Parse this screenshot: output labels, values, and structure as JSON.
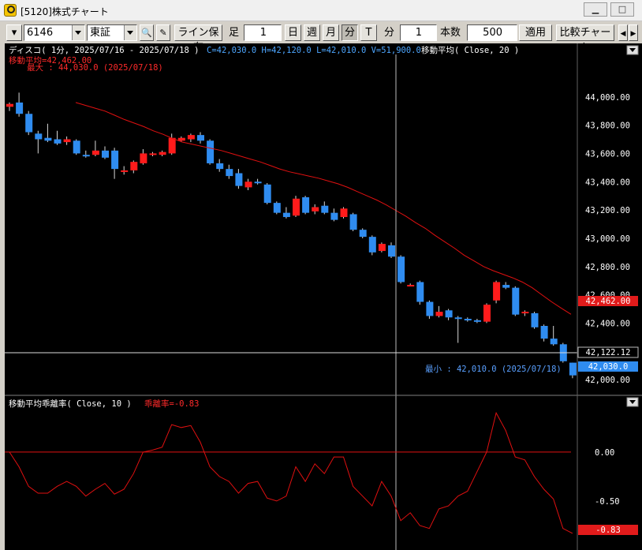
{
  "window": {
    "title": "[5120]株式チャート",
    "minimize_icon": "minimize-icon",
    "maximize_icon": "maximize-icon",
    "close_icon": "close-icon"
  },
  "toolbar": {
    "code": "6146",
    "market": "東証",
    "line_save_label": "ライン保存",
    "ashi_label": "足",
    "ashi_value": "1",
    "day_label": "日",
    "week_label": "週",
    "month_label": "月",
    "minute_label": "分",
    "tick_label": "T",
    "bun_label": "分",
    "bun_value": "1",
    "honsu_label": "本数",
    "honsu_value": "500",
    "apply_label": "適用",
    "compare_label": "比較チャート",
    "search_icon": "search-icon",
    "edit_icon": "edit-icon"
  },
  "colors": {
    "up": "#ff1b1b",
    "down": "#2f8cf0",
    "ma": "#e01010",
    "axis_text": "#ffffff",
    "info_blue": "#5aa0ff"
  },
  "main_panel": {
    "header_name": "ディスコ( 1分, 2025/07/16 - 2025/07/18 )",
    "ohlcv": "C=42,030.0 H=42,120.0 L=42,010.0 V=51,900.0",
    "ma_label": "移動平均( Close, 20 )",
    "ma_value_label": "移動平均=42,462.00",
    "max_label": "最大 : 44,030.0 (2025/07/18)",
    "min_label": "最小 : 42,010.0 (2025/07/18)",
    "ma_tag": "42,462.00",
    "cursor_tag": "42,122.12",
    "last_tag": "42,030.0"
  },
  "sub_panel": {
    "header_name": "移動平均乖離率( Close, 10 )",
    "value_label": "乖離率=-0.83",
    "last_tag": "-0.83"
  },
  "chart_data": [
    {
      "type": "candlestick",
      "title": "ディスコ( 1分, 2025/07/16 - 2025/07/18 )",
      "ylim": [
        41900,
        44300
      ],
      "y_ticks": [
        44000,
        43800,
        43600,
        43400,
        43200,
        43000,
        42800,
        42600,
        42400,
        42200,
        42000
      ],
      "y_tick_labels": [
        "44,000.00",
        "43,800.00",
        "43,600.00",
        "43,400.00",
        "43,200.00",
        "43,000.00",
        "42,800.00",
        "42,600.00",
        "42,400.00",
        "42,200.00",
        "42,000.00"
      ],
      "candles": [
        {
          "o": 43930,
          "h": 43960,
          "l": 43900,
          "c": 43950
        },
        {
          "o": 43960,
          "h": 44030,
          "l": 43860,
          "c": 43880
        },
        {
          "o": 43880,
          "h": 43900,
          "l": 43730,
          "c": 43750
        },
        {
          "o": 43740,
          "h": 43760,
          "l": 43600,
          "c": 43700
        },
        {
          "o": 43710,
          "h": 43810,
          "l": 43680,
          "c": 43690
        },
        {
          "o": 43700,
          "h": 43760,
          "l": 43660,
          "c": 43670
        },
        {
          "o": 43680,
          "h": 43720,
          "l": 43660,
          "c": 43700
        },
        {
          "o": 43690,
          "h": 43700,
          "l": 43590,
          "c": 43600
        },
        {
          "o": 43590,
          "h": 43620,
          "l": 43570,
          "c": 43580
        },
        {
          "o": 43590,
          "h": 43690,
          "l": 43580,
          "c": 43620
        },
        {
          "o": 43620,
          "h": 43650,
          "l": 43560,
          "c": 43570
        },
        {
          "o": 43620,
          "h": 43640,
          "l": 43420,
          "c": 43490
        },
        {
          "o": 43470,
          "h": 43510,
          "l": 43450,
          "c": 43480
        },
        {
          "o": 43480,
          "h": 43550,
          "l": 43460,
          "c": 43540
        },
        {
          "o": 43530,
          "h": 43630,
          "l": 43520,
          "c": 43600
        },
        {
          "o": 43590,
          "h": 43610,
          "l": 43580,
          "c": 43600
        },
        {
          "o": 43590,
          "h": 43620,
          "l": 43580,
          "c": 43610
        },
        {
          "o": 43600,
          "h": 43740,
          "l": 43590,
          "c": 43710
        },
        {
          "o": 43690,
          "h": 43720,
          "l": 43680,
          "c": 43710
        },
        {
          "o": 43700,
          "h": 43740,
          "l": 43680,
          "c": 43730
        },
        {
          "o": 43730,
          "h": 43750,
          "l": 43670,
          "c": 43690
        },
        {
          "o": 43690,
          "h": 43700,
          "l": 43520,
          "c": 43530
        },
        {
          "o": 43530,
          "h": 43560,
          "l": 43470,
          "c": 43490
        },
        {
          "o": 43490,
          "h": 43520,
          "l": 43420,
          "c": 43440
        },
        {
          "o": 43460,
          "h": 43490,
          "l": 43350,
          "c": 43370
        },
        {
          "o": 43360,
          "h": 43420,
          "l": 43340,
          "c": 43400
        },
        {
          "o": 43400,
          "h": 43420,
          "l": 43380,
          "c": 43390
        },
        {
          "o": 43380,
          "h": 43390,
          "l": 43240,
          "c": 43250
        },
        {
          "o": 43250,
          "h": 43260,
          "l": 43170,
          "c": 43180
        },
        {
          "o": 43180,
          "h": 43220,
          "l": 43140,
          "c": 43150
        },
        {
          "o": 43160,
          "h": 43300,
          "l": 43150,
          "c": 43280
        },
        {
          "o": 43290,
          "h": 43300,
          "l": 43170,
          "c": 43180
        },
        {
          "o": 43190,
          "h": 43240,
          "l": 43170,
          "c": 43220
        },
        {
          "o": 43230,
          "h": 43260,
          "l": 43170,
          "c": 43180
        },
        {
          "o": 43180,
          "h": 43210,
          "l": 43120,
          "c": 43130
        },
        {
          "o": 43150,
          "h": 43220,
          "l": 43140,
          "c": 43210
        },
        {
          "o": 43170,
          "h": 43180,
          "l": 43050,
          "c": 43060
        },
        {
          "o": 43060,
          "h": 43070,
          "l": 43000,
          "c": 43010
        },
        {
          "o": 43010,
          "h": 43020,
          "l": 42880,
          "c": 42900
        },
        {
          "o": 42910,
          "h": 42970,
          "l": 42900,
          "c": 42960
        },
        {
          "o": 42950,
          "h": 42970,
          "l": 42860,
          "c": 42870
        },
        {
          "o": 42870,
          "h": 42880,
          "l": 42680,
          "c": 42690
        },
        {
          "o": 42660,
          "h": 42680,
          "l": 42660,
          "c": 42670
        },
        {
          "o": 42690,
          "h": 42700,
          "l": 42530,
          "c": 42550
        },
        {
          "o": 42550,
          "h": 42560,
          "l": 42430,
          "c": 42450
        },
        {
          "o": 42450,
          "h": 42520,
          "l": 42440,
          "c": 42480
        },
        {
          "o": 42490,
          "h": 42500,
          "l": 42420,
          "c": 42440
        },
        {
          "o": 42440,
          "h": 42450,
          "l": 42260,
          "c": 42430
        },
        {
          "o": 42430,
          "h": 42440,
          "l": 42410,
          "c": 42420
        },
        {
          "o": 42420,
          "h": 42430,
          "l": 42400,
          "c": 42410
        },
        {
          "o": 42410,
          "h": 42540,
          "l": 42400,
          "c": 42530
        },
        {
          "o": 42560,
          "h": 42700,
          "l": 42540,
          "c": 42690
        },
        {
          "o": 42670,
          "h": 42690,
          "l": 42640,
          "c": 42650
        },
        {
          "o": 42650,
          "h": 42660,
          "l": 42450,
          "c": 42460
        },
        {
          "o": 42470,
          "h": 42490,
          "l": 42450,
          "c": 42480
        },
        {
          "o": 42470,
          "h": 42480,
          "l": 42360,
          "c": 42370
        },
        {
          "o": 42380,
          "h": 42390,
          "l": 42270,
          "c": 42290
        },
        {
          "o": 42290,
          "h": 42380,
          "l": 42240,
          "c": 42250
        },
        {
          "o": 42250,
          "h": 42260,
          "l": 42120,
          "c": 42130
        },
        {
          "o": 42120,
          "h": 42120,
          "l": 42010,
          "c": 42030
        }
      ],
      "ma": [
        43960,
        43940,
        43920,
        43900,
        43870,
        43840,
        43815,
        43790,
        43760,
        43735,
        43705,
        43680,
        43665,
        43650,
        43635,
        43620,
        43600,
        43580,
        43560,
        43540,
        43515,
        43490,
        43470,
        43455,
        43440,
        43425,
        43405,
        43385,
        43360,
        43330,
        43300,
        43270,
        43235,
        43195,
        43155,
        43110,
        43070,
        43020,
        42975,
        42930,
        42880,
        42840,
        42800,
        42770,
        42745,
        42720,
        42690,
        42650,
        42600,
        42550,
        42505,
        42462
      ]
    },
    {
      "type": "line",
      "title": "移動平均乖離率( Close, 10 )",
      "ylim": [
        -1.0,
        0.45
      ],
      "y_ticks": [
        0.0,
        -0.5
      ],
      "y_tick_labels": [
        "0.00",
        "-0.50"
      ],
      "values": [
        0.0,
        -0.15,
        -0.35,
        -0.42,
        -0.42,
        -0.35,
        -0.3,
        -0.35,
        -0.45,
        -0.38,
        -0.32,
        -0.43,
        -0.38,
        -0.22,
        0.0,
        0.02,
        0.05,
        0.28,
        0.25,
        0.27,
        0.1,
        -0.15,
        -0.25,
        -0.3,
        -0.42,
        -0.32,
        -0.3,
        -0.47,
        -0.5,
        -0.45,
        -0.15,
        -0.3,
        -0.12,
        -0.22,
        -0.05,
        -0.05,
        -0.35,
        -0.45,
        -0.55,
        -0.3,
        -0.45,
        -0.7,
        -0.62,
        -0.75,
        -0.78,
        -0.58,
        -0.55,
        -0.45,
        -0.4,
        -0.2,
        0.0,
        0.4,
        0.22,
        -0.05,
        -0.08,
        -0.25,
        -0.38,
        -0.48,
        -0.78,
        -0.83
      ]
    }
  ]
}
